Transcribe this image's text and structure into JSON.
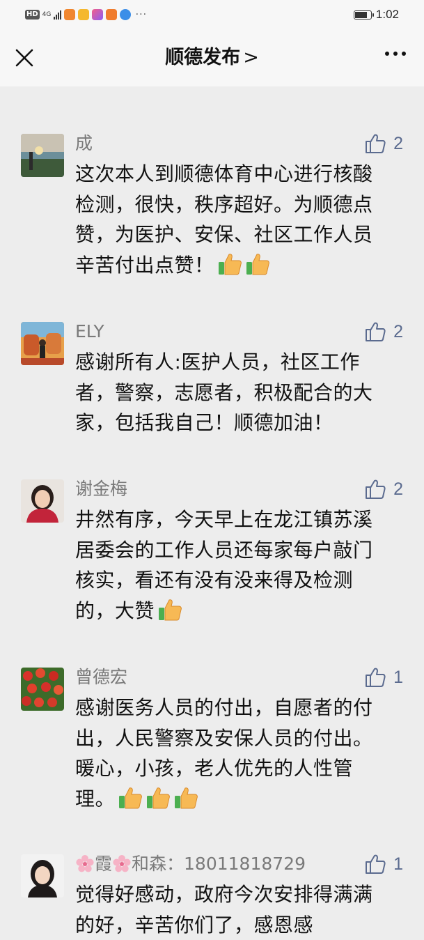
{
  "status_bar": {
    "hd": "HD",
    "network": "4G",
    "time": "1:02",
    "battery_level": 0.85,
    "more": "···"
  },
  "nav": {
    "title": "顺德发布",
    "chevron": ">",
    "close_icon": "close-icon",
    "more_icon": "more-icon"
  },
  "comments": [
    {
      "name": "成",
      "likes": "2",
      "text": "这次本人到顺德体育中心进行核酸检测，很快，秩序超好。为顺德点赞，为医护、安保、社区工作人员辛苦付出点赞！",
      "emojis": [
        "thumbs-up-emoji",
        "thumbs-up-emoji"
      ]
    },
    {
      "name": "ELY",
      "likes": "2",
      "text": "感谢所有人:医护人员，社区工作者，警察，志愿者，积极配合的大家，包括我自己！顺德加油！",
      "emojis": []
    },
    {
      "name": "谢金梅",
      "likes": "2",
      "text": "井然有序，今天早上在龙江镇苏溪居委会的工作人员还每家每户敲门核实，看还有没有没来得及检测的，大赞",
      "emojis": [
        "thumbs-up-emoji"
      ]
    },
    {
      "name": "曾德宏",
      "likes": "1",
      "text": "感谢医务人员的付出，自愿者的付出，人民警察及安保人员的付出。暖心，小孩，老人优先的人性管理。",
      "emojis": [
        "thumbs-up-emoji",
        "thumbs-up-emoji",
        "thumbs-up-emoji"
      ]
    },
    {
      "name_parts": [
        "霞",
        "和森：18011818729"
      ],
      "likes": "1",
      "text": "觉得好感动，政府今次安排得满满的好，辛苦你们了，感恩感",
      "emojis": []
    }
  ]
}
